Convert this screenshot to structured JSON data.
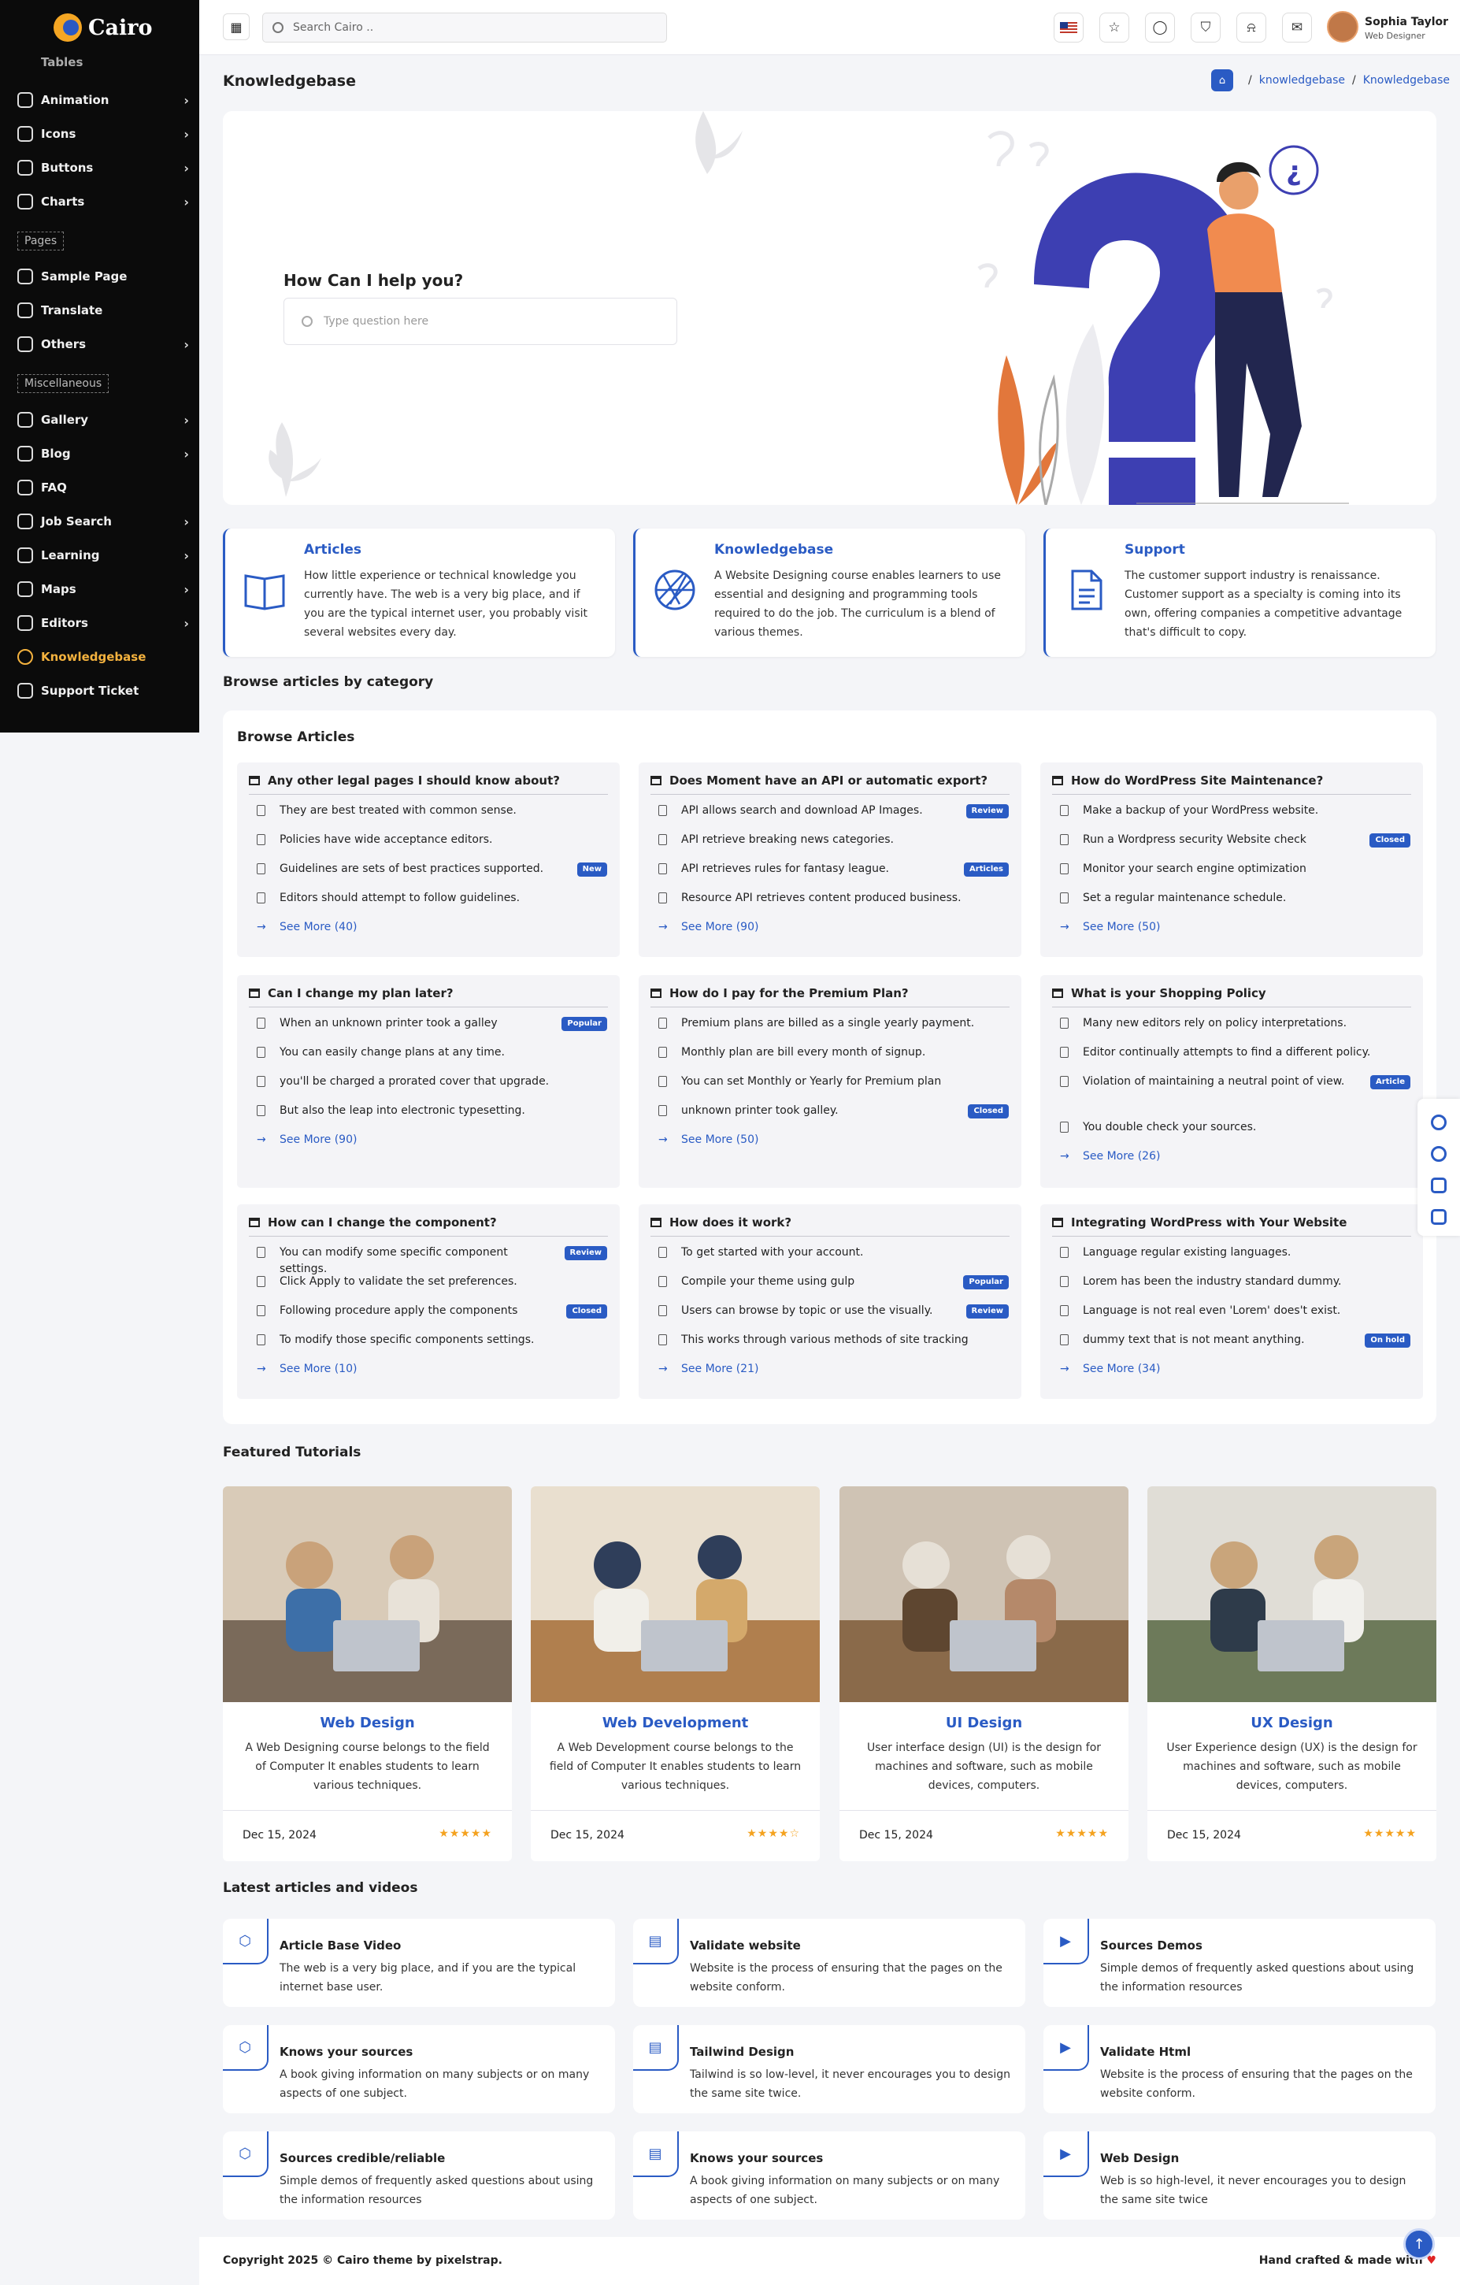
{
  "brand": {
    "name": "Cairo"
  },
  "sidebar": {
    "partial_top": "Tables",
    "items": [
      {
        "label": "Animation",
        "has_children": true
      },
      {
        "label": "Icons",
        "has_children": true
      },
      {
        "label": "Buttons",
        "has_children": true
      },
      {
        "label": "Charts",
        "has_children": true
      }
    ],
    "cap_pages": "Pages",
    "pages": [
      {
        "label": "Sample Page",
        "has_children": false
      },
      {
        "label": "Translate",
        "has_children": false
      },
      {
        "label": "Others",
        "has_children": true
      }
    ],
    "cap_misc": "Miscellaneous",
    "misc": [
      {
        "label": "Gallery",
        "has_children": true
      },
      {
        "label": "Blog",
        "has_children": true
      },
      {
        "label": "FAQ",
        "has_children": false
      },
      {
        "label": "Job Search",
        "has_children": true
      },
      {
        "label": "Learning",
        "has_children": true
      },
      {
        "label": "Maps",
        "has_children": true
      },
      {
        "label": "Editors",
        "has_children": true
      },
      {
        "label": "Knowledgebase",
        "has_children": false,
        "active": true
      },
      {
        "label": "Support Ticket",
        "has_children": false
      }
    ],
    "active_color": "#f4b23e"
  },
  "header": {
    "search_placeholder": "Search Cairo ..",
    "user_name": "Sophia Taylor",
    "user_role": "Web Designer",
    "icons": [
      "flag-icon",
      "star-icon",
      "bulb-icon",
      "cart-icon",
      "bell-icon",
      "message-icon"
    ]
  },
  "page": {
    "title": "Knowledgebase",
    "breadcrumb": [
      "knowledgebase",
      "Knowledgebase"
    ]
  },
  "hero": {
    "heading": "How Can I help you?",
    "placeholder": "Type question here"
  },
  "info_cards": [
    {
      "title": "Articles",
      "icon": "book-icon",
      "text": "How little experience or technical knowledge you currently have. The web is a very big place, and if you are the typical internet user, you probably visit several websites every day."
    },
    {
      "title": "Knowledgebase",
      "icon": "aperture-icon",
      "text": "A Website Designing course enables learners to use essential and designing and programming tools required to do the job. The curriculum is a blend of various themes."
    },
    {
      "title": "Support",
      "icon": "file-text-icon",
      "text": "The customer support industry is renaissance. Customer support as a specialty is coming into its own, offering companies a competitive advantage that's difficult to copy."
    }
  ],
  "browse": {
    "section_title": "Browse articles by category",
    "card_title": "Browse Articles",
    "categories": [
      {
        "title": "Any other legal pages I should know about?",
        "items": [
          {
            "text": "They are best treated with common sense."
          },
          {
            "text": "Policies have wide acceptance editors."
          },
          {
            "text": "Guidelines are sets of best practices supported.",
            "badge": "New"
          },
          {
            "text": "Editors should attempt to follow guidelines."
          }
        ],
        "more": "See More (40)"
      },
      {
        "title": "Does Moment have an API or automatic export?",
        "items": [
          {
            "text": "API allows search and download AP Images.",
            "badge": "Review"
          },
          {
            "text": "API retrieve breaking news categories."
          },
          {
            "text": "API retrieves rules for fantasy league.",
            "badge": "Articles"
          },
          {
            "text": "Resource API retrieves content produced business."
          }
        ],
        "more": "See More (90)"
      },
      {
        "title": "How do WordPress Site Maintenance?",
        "items": [
          {
            "text": "Make a backup of your WordPress website."
          },
          {
            "text": "Run a Wordpress security Website check",
            "badge": "Closed"
          },
          {
            "text": "Monitor your search engine optimization"
          },
          {
            "text": "Set a regular maintenance schedule."
          }
        ],
        "more": "See More (50)"
      },
      {
        "title": "Can I change my plan later?",
        "items": [
          {
            "text": "When an unknown printer took a galley",
            "badge": "Popular"
          },
          {
            "text": "You can easily change plans at any time."
          },
          {
            "text": "you'll be charged a prorated cover that upgrade."
          },
          {
            "text": "But also the leap into electronic typesetting."
          }
        ],
        "more": "See More (90)"
      },
      {
        "title": "How do I pay for the Premium Plan?",
        "items": [
          {
            "text": "Premium plans are billed as a single yearly payment."
          },
          {
            "text": "Monthly plan are bill every month of signup."
          },
          {
            "text": "You can set Monthly or Yearly for Premium plan"
          },
          {
            "text": "unknown printer took galley.",
            "badge": "Closed"
          }
        ],
        "more": "See More (50)"
      },
      {
        "title": "What is your Shopping Policy",
        "items": [
          {
            "text": "Many new editors rely on policy interpretations."
          },
          {
            "text": "Editor continually attempts to find a different policy."
          },
          {
            "text": "Violation of maintaining a neutral point of view.",
            "badge": "Article"
          },
          {
            "text": "You double check your sources."
          }
        ],
        "more": "See More (26)"
      },
      {
        "title": "How can I change the component?",
        "items": [
          {
            "text": "You can modify some specific component settings.",
            "badge": "Review"
          },
          {
            "text": "Click Apply to validate the set preferences."
          },
          {
            "text": "Following procedure apply the components",
            "badge": "Closed"
          },
          {
            "text": "To modify those specific components settings."
          }
        ],
        "more": "See More (10)"
      },
      {
        "title": "How does it work?",
        "items": [
          {
            "text": "To get started with your account."
          },
          {
            "text": "Compile your theme using gulp",
            "badge": "Popular"
          },
          {
            "text": "Users can browse by topic or use the visually.",
            "badge": "Review"
          },
          {
            "text": "This works through various methods of site tracking"
          }
        ],
        "more": "See More (21)"
      },
      {
        "title": "Integrating WordPress with Your Website",
        "items": [
          {
            "text": "Language regular existing languages."
          },
          {
            "text": "Lorem has been the industry standard dummy."
          },
          {
            "text": "Language is not real even 'Lorem' does't exist."
          },
          {
            "text": "dummy text that is not meant anything.",
            "badge": "On hold"
          }
        ],
        "more": "See More (34)"
      }
    ]
  },
  "tutorials": {
    "section_title": "Featured Tutorials",
    "items": [
      {
        "title": "Web Design",
        "text": "A Web Designing course belongs to the field of Computer It enables students to learn various techniques.",
        "date": "Dec 15, 2024",
        "rating": 5
      },
      {
        "title": "Web Development",
        "text": "A Web Development course belongs to the field of Computer It enables students to learn various techniques.",
        "date": "Dec 15, 2024",
        "rating": 4
      },
      {
        "title": "UI Design",
        "text": "User interface design (UI) is the design for machines and software, such as mobile devices, computers.",
        "date": "Dec 15, 2024",
        "rating": 5
      },
      {
        "title": "UX Design",
        "text": "User Experience design (UX) is the design for machines and software, such as mobile devices, computers.",
        "date": "Dec 15, 2024",
        "rating": 5
      }
    ]
  },
  "latest": {
    "section_title": "Latest articles and videos",
    "items": [
      {
        "title": "Article Base Video",
        "text": "The web is a very big place, and if you are the typical internet base user.",
        "icon": "codepen-icon"
      },
      {
        "title": "Validate website",
        "text": "Website is the process of ensuring that the pages on the website conform.",
        "icon": "file-icon"
      },
      {
        "title": "Sources Demos",
        "text": "Simple demos of frequently asked questions about using the information resources",
        "icon": "youtube-icon"
      },
      {
        "title": "Knows your sources",
        "text": "A book giving information on many subjects or on many aspects of one subject.",
        "icon": "codepen-icon"
      },
      {
        "title": "Tailwind Design",
        "text": "Tailwind is so low-level, it never encourages you to design the same site twice.",
        "icon": "file-icon"
      },
      {
        "title": "Validate Html",
        "text": "Website is the process of ensuring that the pages on the website conform.",
        "icon": "youtube-icon"
      },
      {
        "title": "Sources credible/reliable",
        "text": "Simple demos of frequently asked questions about using the information resources",
        "icon": "codepen-icon"
      },
      {
        "title": "Knows your sources",
        "text": "A book giving information on many subjects or on many aspects of one subject.",
        "icon": "file-icon"
      },
      {
        "title": "Web Design",
        "text": "Web is so high-level, it never encourages you to design the same site twice",
        "icon": "youtube-icon"
      }
    ]
  },
  "footer": {
    "copyright": "Copyright 2025 © Cairo theme by pixelstrap.",
    "credit": "Hand crafted & made with",
    "heart": "♥"
  },
  "colors": {
    "accent": "#2a5bc4",
    "sidebar_bg": "#0b0b0b",
    "star": "#f4a21f"
  }
}
